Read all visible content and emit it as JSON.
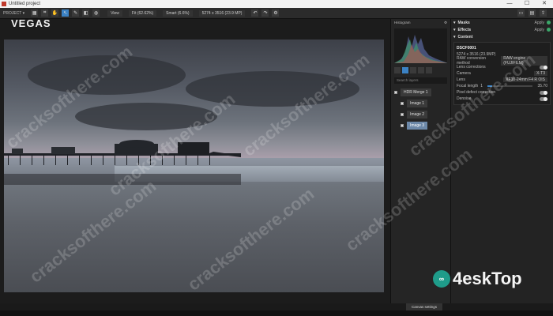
{
  "window": {
    "title": "Untitled project",
    "minimize": "—",
    "maximize": "☐",
    "close": "✕"
  },
  "toolbar": {
    "project_label": "PROJECT ▾",
    "view_label": "View",
    "zoom_label": "Fit (62.62%)",
    "compare_label": "Smart (6.6%)",
    "size_label": "5274 x 3516 (23.9 MP)"
  },
  "brand": "VEGAS",
  "histogram": {
    "label": "Histogram"
  },
  "layers": {
    "search_placeholder": "Search layers",
    "items": [
      {
        "label": "HDR Merge 1"
      },
      {
        "label": "Image 1"
      },
      {
        "label": "Image 2"
      },
      {
        "label": "Image 3"
      }
    ]
  },
  "right_panel": {
    "masks": "Masks",
    "effects": "Effects",
    "content": "Content",
    "apply": "Apply",
    "file_name": "DSCF0001",
    "file_info": "5274 x 3516 (23.9MP)",
    "raw_method_label": "RAW conversion method",
    "raw_method_value": "RAW engine (FUJIFILM)",
    "lens_corrections": "Lens corrections",
    "camera_label": "Camera",
    "camera_value": "X-T3",
    "lens_label": "Lens",
    "lens_value": "XF10-24mm F4 R OIS",
    "focal_label": "Focal length",
    "focal_value": "1",
    "focal_max": "35.70",
    "pixel_defect_label": "Pixel defect correction",
    "denoise_label": "Denoise"
  },
  "bottom_button": "Canvas settings",
  "watermark_text": "cracksofthere.com",
  "logo": {
    "mark": "∞",
    "text": "4eskTop"
  },
  "colors": {
    "accent": "#3b82c4",
    "selected": "#6c88a8",
    "apply_dot": "#3ba86a"
  }
}
